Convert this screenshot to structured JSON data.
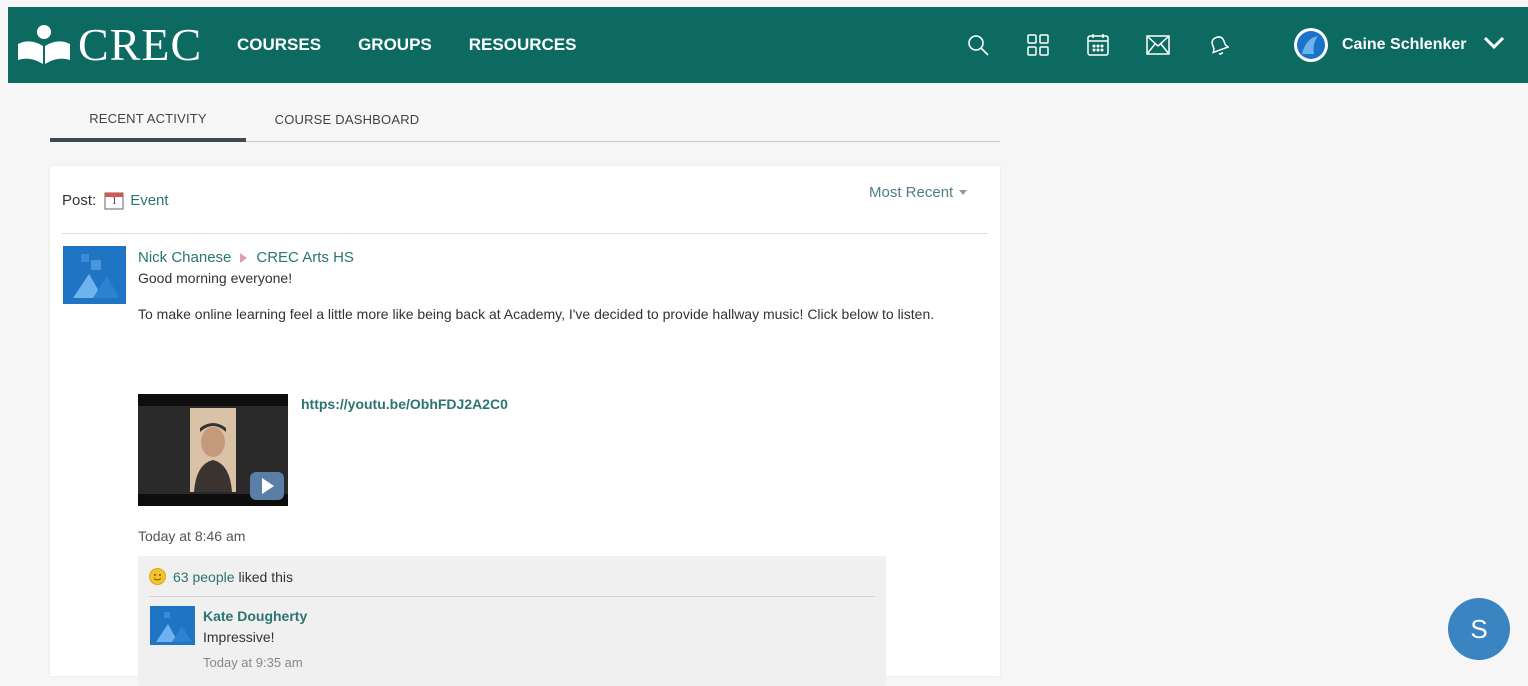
{
  "header": {
    "logo_text": "CREC",
    "nav": [
      "COURSES",
      "GROUPS",
      "RESOURCES"
    ],
    "icons": [
      "search-icon",
      "apps-grid-icon",
      "calendar-icon",
      "mail-icon",
      "notification-bell-icon"
    ],
    "user_name": "Caine Schlenker",
    "brand_color": "#0c6a61"
  },
  "tabs": [
    "RECENT ACTIVITY",
    "COURSE DASHBOARD"
  ],
  "feed": {
    "post_label": "Post:",
    "event_icon_number": "1",
    "event_label": "Event",
    "sort_label": "Most Recent",
    "post": {
      "author": "Nick Chanese",
      "group": "CREC Arts HS",
      "greeting": "Good morning everyone!",
      "body": "To make online learning feel a little more like being back at Academy, I've decided to provide hallway music! Click below to listen.",
      "link": "https://youtu.be/ObhFDJ2A2C0",
      "timestamp": "Today at 8:46 am",
      "likes_count": "63 people",
      "likes_suffix": "liked this",
      "comment": {
        "author": "Kate Dougherty",
        "text": "Impressive!",
        "time": "Today at 9:35 am"
      }
    }
  },
  "chat_bubble_letter": "S"
}
